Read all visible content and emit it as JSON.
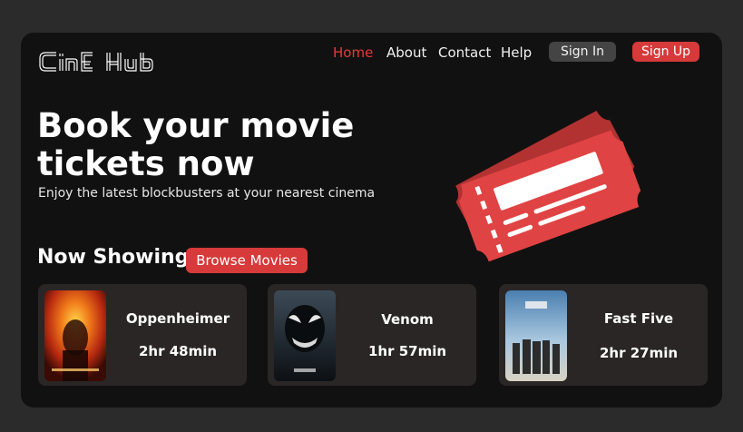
{
  "brand": {
    "logo_text": "CINE HUB",
    "accent_color": "#d63a3a"
  },
  "nav": {
    "links": [
      {
        "label": "Home",
        "active": true
      },
      {
        "label": "About",
        "active": false
      },
      {
        "label": "Contact",
        "active": false
      },
      {
        "label": "Help",
        "active": false
      }
    ],
    "sign_in_label": "Sign In",
    "sign_up_label": "Sign Up"
  },
  "hero": {
    "title_line1": "Book your movie",
    "title_line2": "tickets now",
    "subtitle": "Enjoy the latest blockbusters at your nearest cinema",
    "illustration": "ticket-icon"
  },
  "now_showing": {
    "heading": "Now Showing",
    "browse_label": "Browse Movies",
    "movies": [
      {
        "title": "Oppenheimer",
        "runtime": "2hr 48min",
        "poster": "oppenheimer-poster"
      },
      {
        "title": "Venom",
        "runtime": "1hr 57min",
        "poster": "venom-poster"
      },
      {
        "title": "Fast Five",
        "runtime": "2hr 27min",
        "poster": "fast-five-poster"
      }
    ]
  }
}
